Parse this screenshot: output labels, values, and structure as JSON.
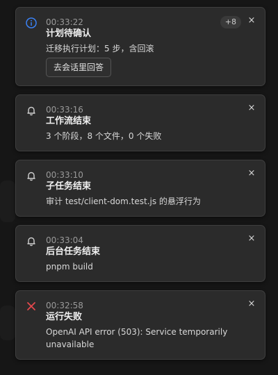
{
  "notifications": [
    {
      "icon": "info-icon",
      "time": "00:33:22",
      "title": "计划待确认",
      "body": "迁移执行计划：5 步，含回滚",
      "badge": "+8",
      "action_label": "去会话里回答",
      "close": "×"
    },
    {
      "icon": "bell-icon",
      "time": "00:33:16",
      "title": "工作流结束",
      "body": "3 个阶段，8 个文件，0 个失败",
      "close": "×"
    },
    {
      "icon": "bell-icon",
      "time": "00:33:10",
      "title": "子任务结束",
      "body": "审计 test/client-dom.test.js 的悬浮行为",
      "close": "×"
    },
    {
      "icon": "bell-icon",
      "time": "00:33:04",
      "title": "后台任务结束",
      "body": "pnpm build",
      "close": "×"
    },
    {
      "icon": "error-x-icon",
      "time": "00:32:58",
      "title": "运行失败",
      "body": "OpenAI API error (503): Service temporarily unavailable",
      "close": "×"
    }
  ],
  "colors": {
    "info": "#3b82f6",
    "error": "#e5484d",
    "bell": "#cfcfcf"
  }
}
